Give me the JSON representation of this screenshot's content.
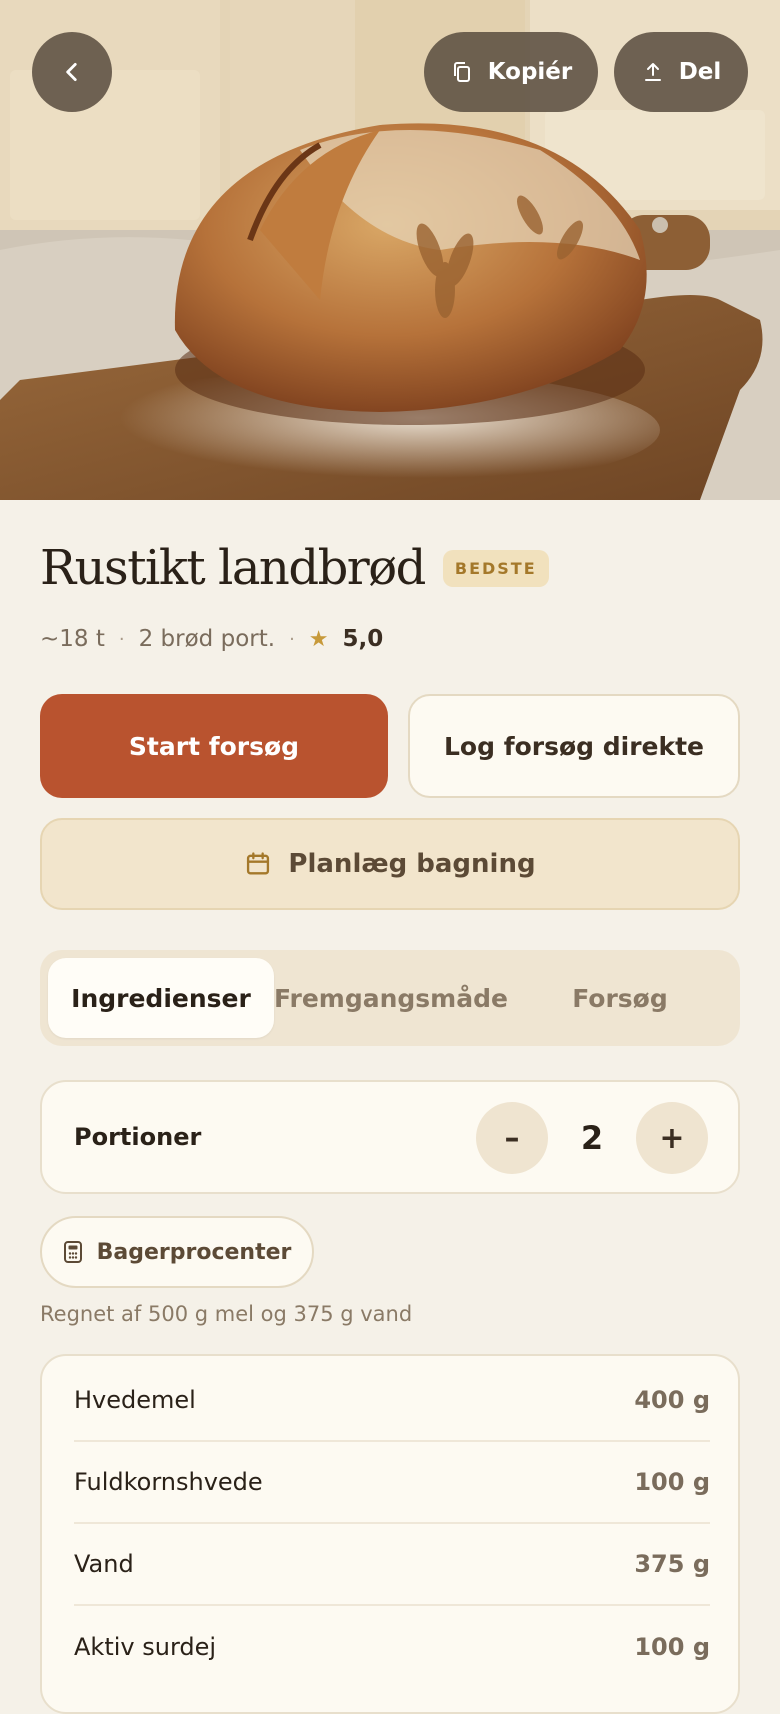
{
  "header": {
    "copy_label": "Kopiér",
    "share_label": "Del"
  },
  "recipe": {
    "title": "Rustikt landbrød",
    "badge": "BEDSTE",
    "time": "~18 t",
    "yield": "2 brød port.",
    "rating": "5,0"
  },
  "actions": {
    "start_label": "Start forsøg",
    "log_label": "Log forsøg direkte",
    "plan_label": "Planlæg bagning"
  },
  "tabs": [
    {
      "label": "Ingredienser",
      "active": true
    },
    {
      "label": "Fremgangsmåde",
      "active": false
    },
    {
      "label": "Forsøg",
      "active": false
    }
  ],
  "portions": {
    "label": "Portioner",
    "minus": "–",
    "value": "2",
    "plus": "+"
  },
  "bakers_percent": {
    "label": "Bagerprocenter",
    "note": "Regnet af 500 g mel og 375 g vand"
  },
  "ingredients": [
    {
      "name": "Hvedemel",
      "amount": "400 g"
    },
    {
      "name": "Fuldkornshvede",
      "amount": "100 g"
    },
    {
      "name": "Vand",
      "amount": "375 g"
    },
    {
      "name": "Aktiv surdej",
      "amount": "100 g"
    }
  ],
  "colors": {
    "background": "#f5f1e8",
    "primary": "#b9532f",
    "badge_bg": "#f1e1bd",
    "badge_text": "#a4782a",
    "star": "#c79a3a"
  },
  "icons": {
    "back": "chevron-left-icon",
    "copy": "copy-icon",
    "share": "share-icon",
    "plan": "calendar-icon",
    "bakers_percent": "calculator-icon",
    "rating": "star-icon"
  }
}
